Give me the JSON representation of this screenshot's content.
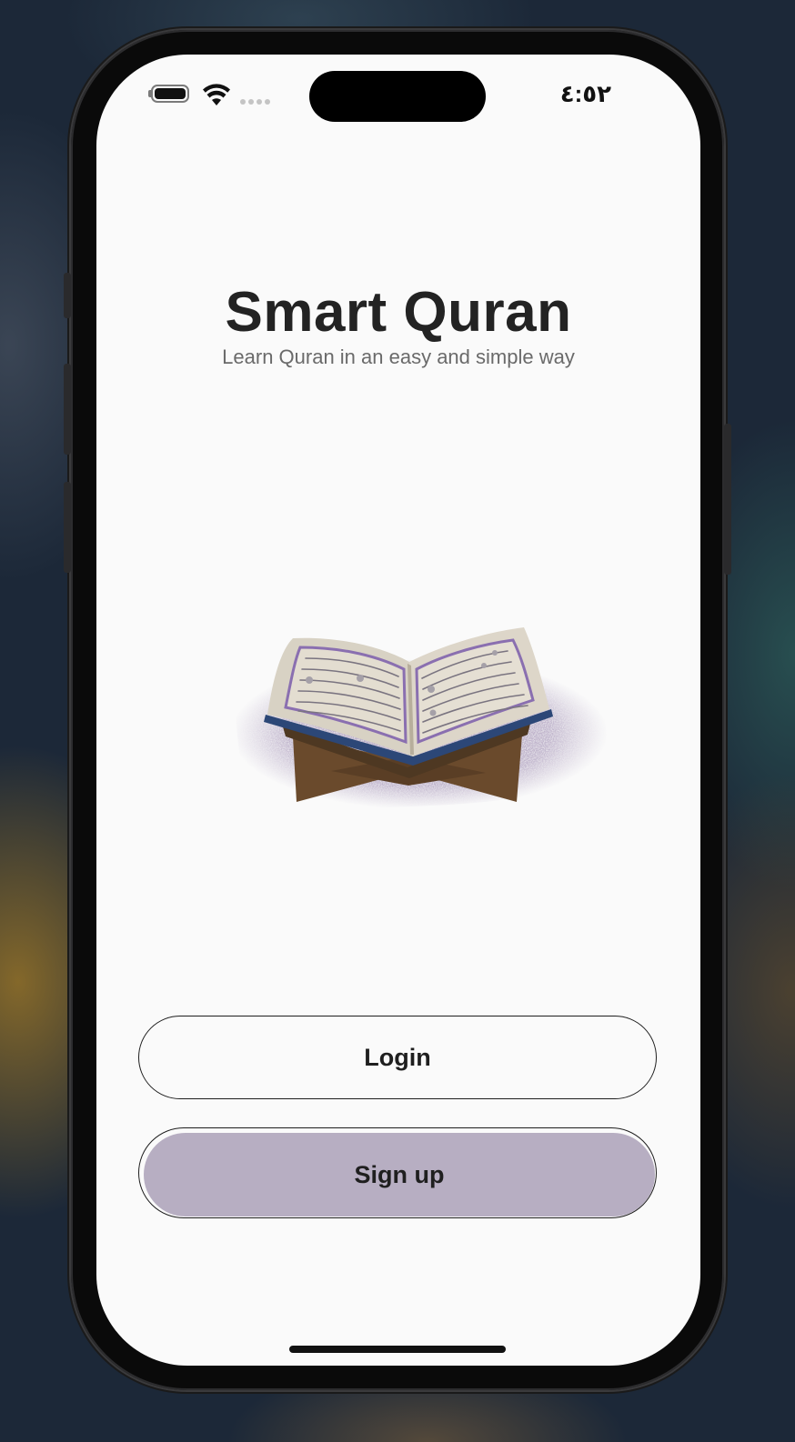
{
  "status_bar": {
    "time": "٤:٥٢"
  },
  "hero": {
    "title": "Smart Quran",
    "subtitle": "Learn Quran in an easy and simple way",
    "illustration_icon": "quran-on-stand-illustration"
  },
  "actions": {
    "login_label": "Login",
    "signup_label": "Sign up"
  },
  "colors": {
    "screen_background": "#fafafa",
    "title_text": "#232323",
    "subtitle_text": "#6a6a6a",
    "signup_fill": "#b7aec2",
    "button_border": "#1e1e1e",
    "book_border_purple": "#8a6fb0",
    "stand_brown": "#6a4a2c"
  }
}
